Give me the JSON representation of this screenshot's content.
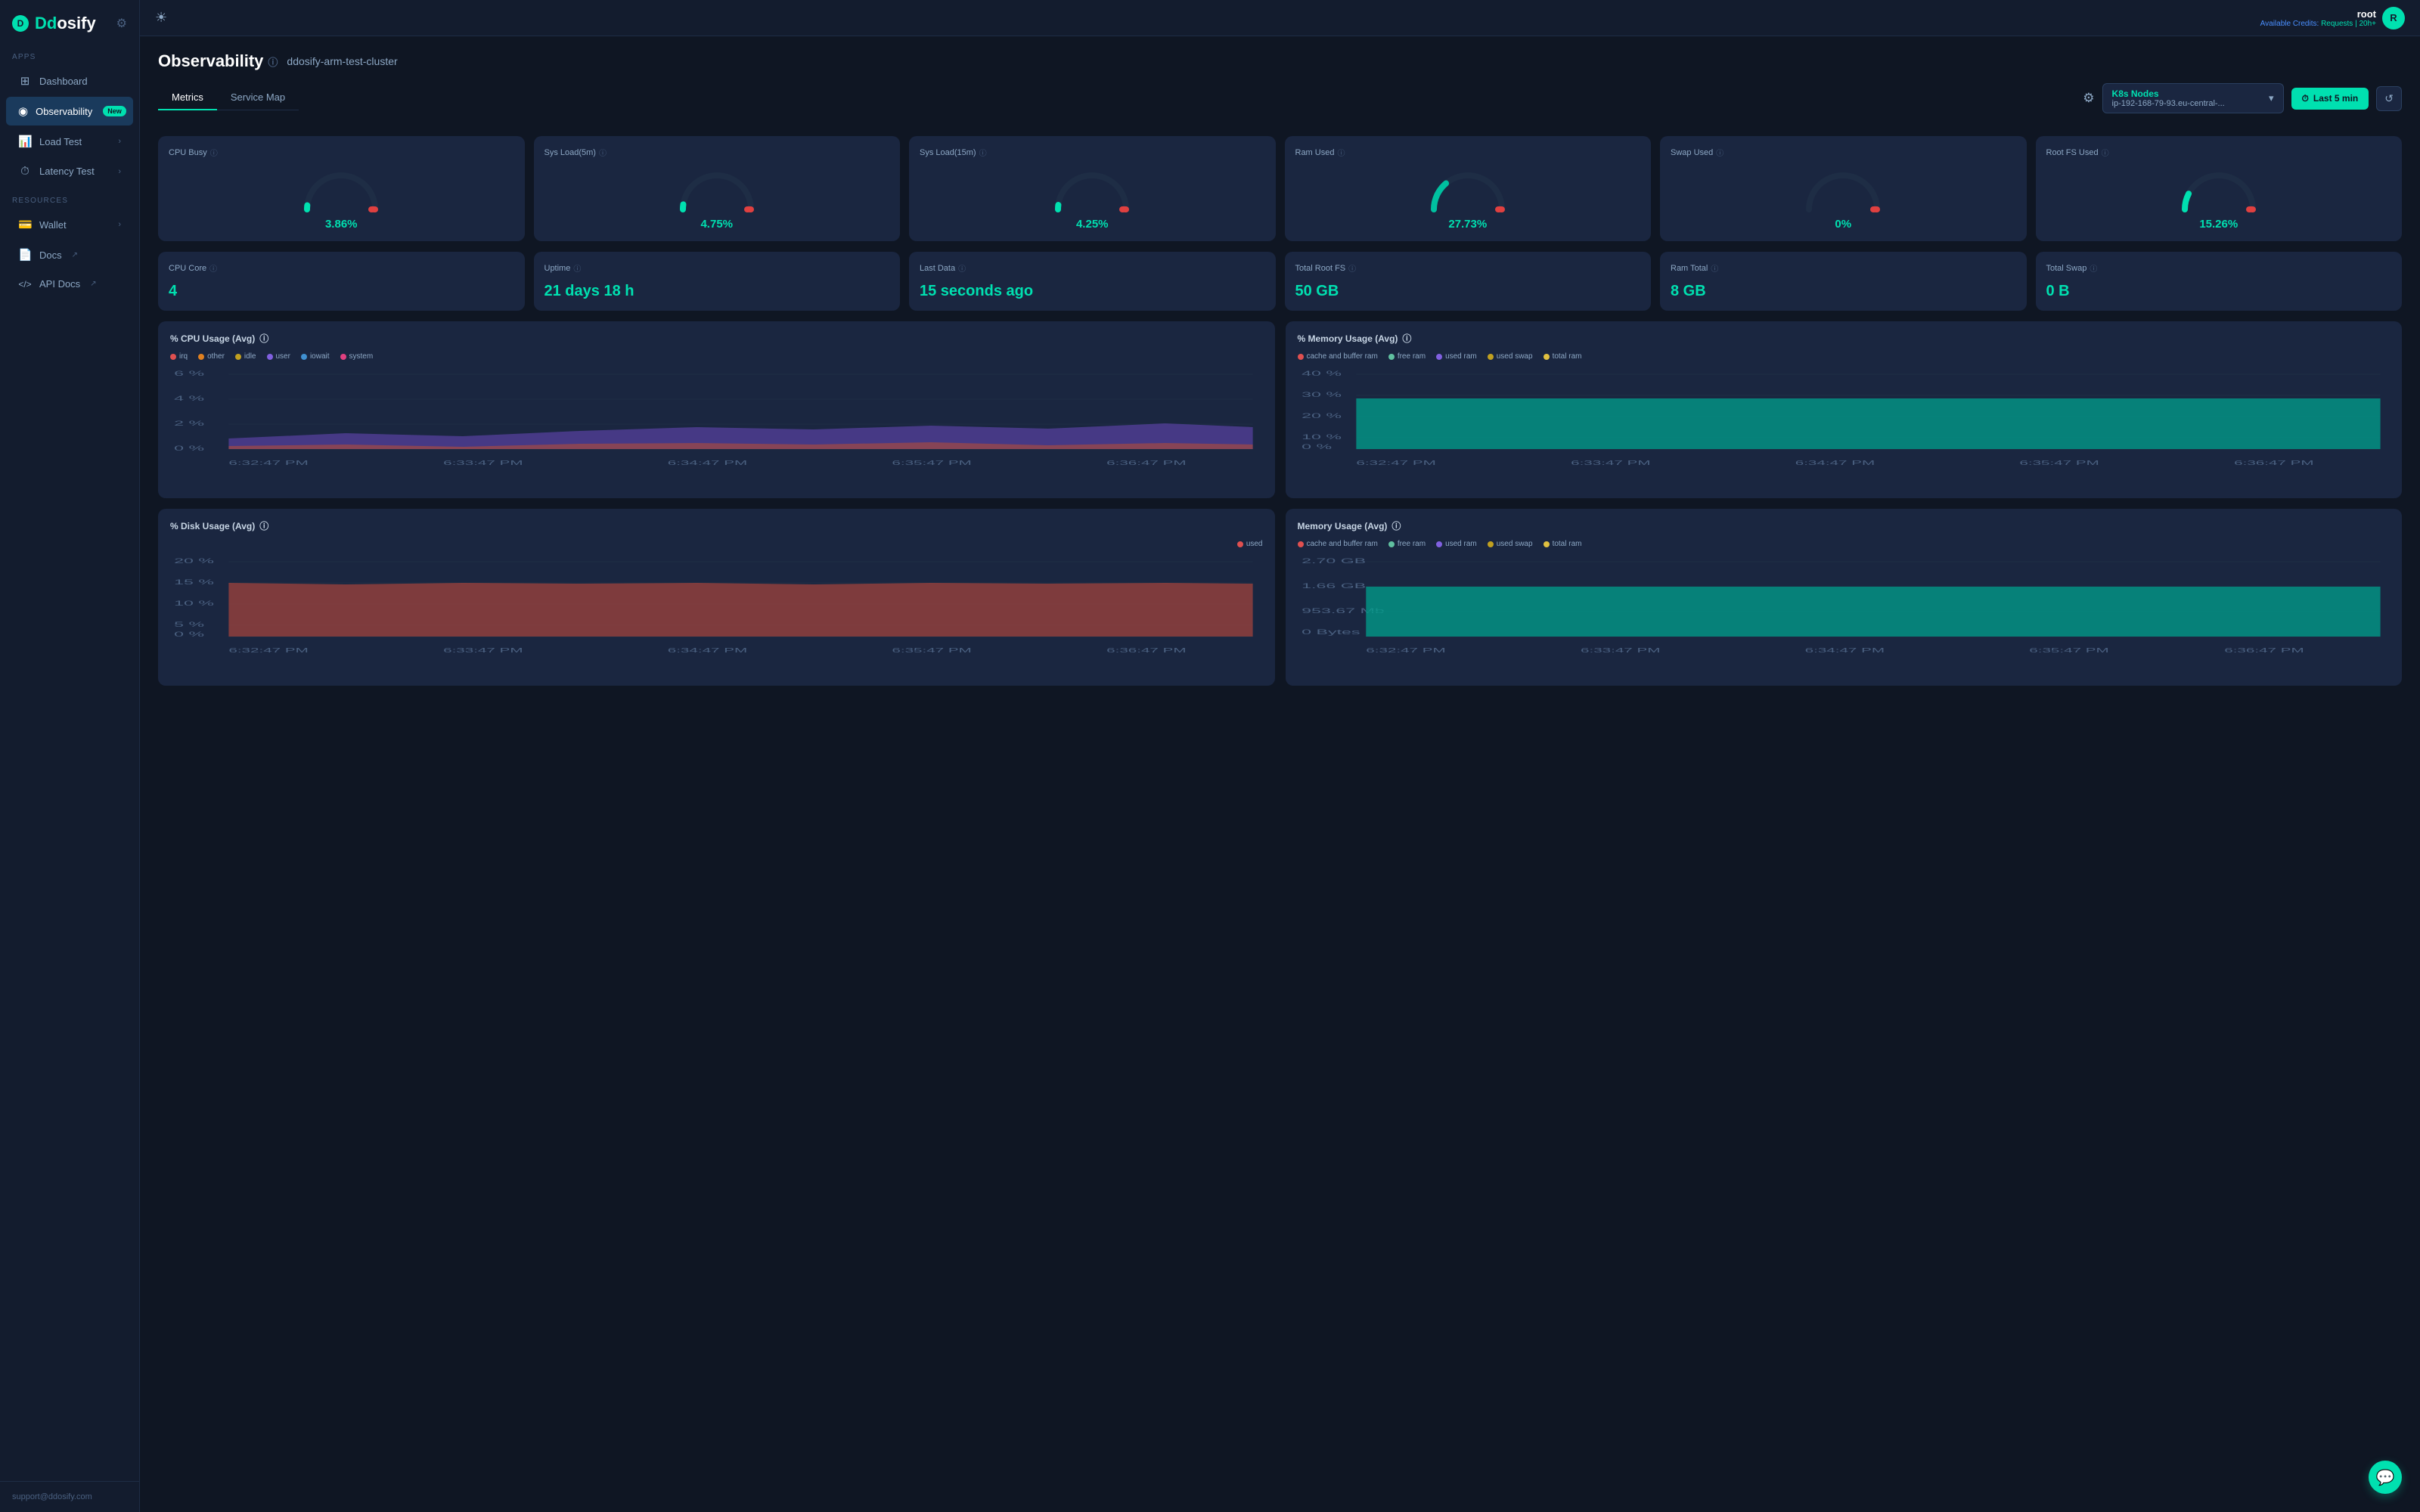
{
  "app": {
    "logo_text_1": "Dd",
    "logo_text_2": "osify"
  },
  "topbar": {
    "theme_icon": "☀",
    "username": "root",
    "credits_label": "Available Credits: Requests | 20h+",
    "avatar_initials": "R"
  },
  "sidebar": {
    "apps_label": "APPS",
    "resources_label": "RESOURCES",
    "nav_items": [
      {
        "label": "Dashboard",
        "icon": "⊞",
        "active": false,
        "badge": null,
        "has_arrow": false
      },
      {
        "label": "Observability",
        "icon": "◉",
        "active": true,
        "badge": "New",
        "has_arrow": false
      },
      {
        "label": "Load Test",
        "icon": "📊",
        "active": false,
        "badge": null,
        "has_arrow": true
      },
      {
        "label": "Latency Test",
        "icon": "⏱",
        "active": false,
        "badge": null,
        "has_arrow": true
      }
    ],
    "resource_items": [
      {
        "label": "Wallet",
        "icon": "💳",
        "active": false,
        "has_arrow": true
      },
      {
        "label": "Docs",
        "icon": "📄",
        "active": false,
        "has_arrow": false,
        "external": true
      },
      {
        "label": "API Docs",
        "icon": "<>",
        "active": false,
        "has_arrow": false,
        "external": true
      }
    ],
    "footer_text": "support@ddosify.com"
  },
  "page": {
    "title": "Observability",
    "cluster_name": "ddosify-arm-test-cluster",
    "tabs": [
      {
        "label": "Metrics",
        "active": true
      },
      {
        "label": "Service Map",
        "active": false
      }
    ]
  },
  "controls": {
    "settings_icon": "⚙",
    "node_label": "K8s Nodes",
    "node_ip": "ip-192-168-79-93.eu-central-...",
    "time_button": "Last 5 min",
    "time_icon": "⏱",
    "refresh_icon": "↺"
  },
  "metric_cards_row1": [
    {
      "title": "CPU Busy",
      "value": "3.86%",
      "type": "gauge",
      "color": "#00e0b0",
      "pct": 3.86
    },
    {
      "title": "Sys Load(5m)",
      "value": "4.75%",
      "type": "gauge",
      "color": "#00e0b0",
      "pct": 4.75
    },
    {
      "title": "Sys Load(15m)",
      "value": "4.25%",
      "type": "gauge",
      "color": "#00e0b0",
      "pct": 4.25
    },
    {
      "title": "Ram Used",
      "value": "27.73%",
      "type": "gauge",
      "color": "#00c0a0",
      "pct": 27.73
    },
    {
      "title": "Swap Used",
      "value": "0%",
      "type": "gauge",
      "color": "#e08020",
      "pct": 0
    },
    {
      "title": "Root FS Used",
      "value": "15.26%",
      "type": "gauge",
      "color": "#00e0b0",
      "pct": 15.26
    }
  ],
  "metric_cards_row2": [
    {
      "title": "CPU Core",
      "value": "4",
      "type": "simple"
    },
    {
      "title": "Uptime",
      "value": "21 days 18 h",
      "type": "simple"
    },
    {
      "title": "Last Data",
      "value": "15 seconds ago",
      "type": "simple"
    },
    {
      "title": "Total Root FS",
      "value": "50 GB",
      "type": "simple"
    },
    {
      "title": "Ram Total",
      "value": "8 GB",
      "type": "simple"
    },
    {
      "title": "Total Swap",
      "value": "0 B",
      "type": "simple"
    }
  ],
  "charts": {
    "cpu_usage": {
      "title": "% CPU Usage (Avg)",
      "legend": [
        {
          "label": "irq",
          "color": "#e05050"
        },
        {
          "label": "other",
          "color": "#e08020"
        },
        {
          "label": "idle",
          "color": "#c0a020"
        },
        {
          "label": "user",
          "color": "#8060e0"
        },
        {
          "label": "iowait",
          "color": "#4090d0"
        },
        {
          "label": "system",
          "color": "#e04080"
        }
      ],
      "y_labels": [
        "6%",
        "4%",
        "2%",
        "0%"
      ],
      "x_labels": [
        "6:32:47 PM",
        "6:33:47 PM",
        "6:34:47 PM",
        "6:35:47 PM",
        "6:36:47 PM"
      ]
    },
    "memory_usage_pct": {
      "title": "% Memory Usage (Avg)",
      "legend": [
        {
          "label": "cache and buffer ram",
          "color": "#e05050"
        },
        {
          "label": "free ram",
          "color": "#60c0a0"
        },
        {
          "label": "used ram",
          "color": "#8060e0"
        },
        {
          "label": "used swap",
          "color": "#c0a020"
        },
        {
          "label": "total ram",
          "color": "#e0c040"
        }
      ],
      "y_labels": [
        "40%",
        "30%",
        "20%",
        "10%",
        "0%"
      ],
      "x_labels": [
        "6:32:47 PM",
        "6:33:47 PM",
        "6:34:47 PM",
        "6:35:47 PM",
        "6:36:47 PM"
      ]
    },
    "disk_usage": {
      "title": "% Disk Usage (Avg)",
      "legend": [
        {
          "label": "used",
          "color": "#e05050"
        }
      ],
      "y_labels": [
        "20%",
        "15%",
        "10%",
        "5%",
        "0%"
      ],
      "x_labels": [
        "6:32:47 PM",
        "6:33:47 PM",
        "6:34:47 PM",
        "6:35:47 PM",
        "6:36:47 PM"
      ]
    },
    "memory_usage_abs": {
      "title": "Memory Usage (Avg)",
      "legend": [
        {
          "label": "cache and buffer ram",
          "color": "#e05050"
        },
        {
          "label": "free ram",
          "color": "#60c0a0"
        },
        {
          "label": "used ram",
          "color": "#8060e0"
        },
        {
          "label": "used swap",
          "color": "#c0a020"
        },
        {
          "label": "total ram",
          "color": "#e0c040"
        }
      ],
      "y_labels": [
        "2.70 GB",
        "1.66 GB",
        "953.67 Mb",
        "0 Bytes"
      ],
      "x_labels": [
        "6:32:47 PM",
        "6:33:47 PM",
        "6:34:47 PM",
        "6:35:47 PM",
        "6:36:47 PM"
      ]
    }
  }
}
